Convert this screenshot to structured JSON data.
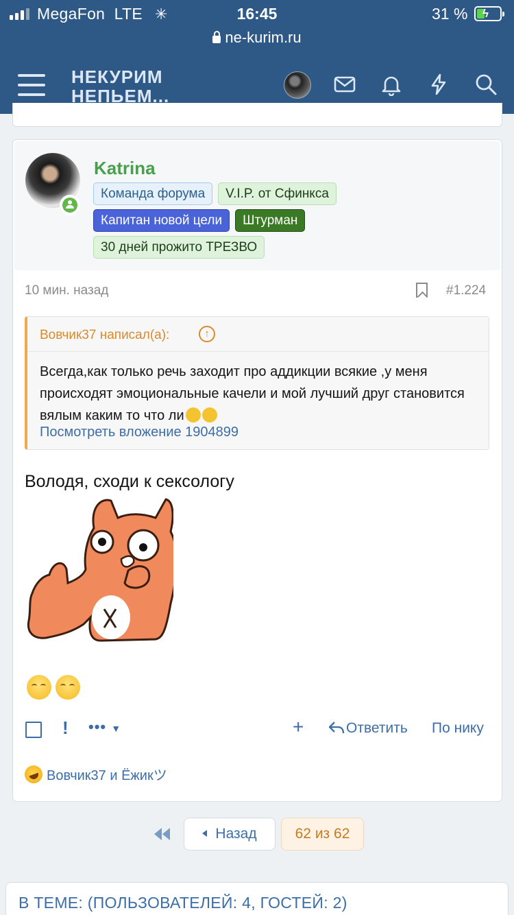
{
  "status_bar": {
    "carrier": "MegaFon",
    "network": "LTE",
    "time": "16:45",
    "battery_percent": "31 %",
    "url": "ne-kurim.ru"
  },
  "header": {
    "logo_line1": "НЕКУРИМ",
    "logo_line2": "НЕПЬЕМ..."
  },
  "post": {
    "author": "Katrina",
    "badges": [
      "Команда форума",
      "V.I.P. от Сфинкса",
      "Капитан новой цели",
      "Штурман",
      "30 дней прожито ТРЕЗВО"
    ],
    "time_ago": "10 мин. назад",
    "post_number": "#1.224",
    "quote": {
      "header": "Вовчик37 написал(а):",
      "text": "Всегда,как только речь заходит про аддикции всякие ,у меня происходят эмоциональные качели и мой лучший друг становится вялым каким то что ли",
      "attachment_link": "Посмотреть вложение 1904899"
    },
    "message": "Володя, сходи к сексологу",
    "actions": {
      "report": "!",
      "more": "•••",
      "plus": "+",
      "reply": "Ответить",
      "by_nick": "По нику"
    },
    "reactions_text": "Вовчик37 и Ёжикツ"
  },
  "pagination": {
    "back": "Назад",
    "pages": "62 из 62"
  },
  "online": {
    "text": "В ТЕМЕ: (ПОЛЬЗОВАТЕЛЕЙ: 4, ГОСТЕЙ: 2)"
  },
  "colors": {
    "header_bg": "#2e5886",
    "link": "#3b6ea8",
    "username": "#47a04a",
    "quote_accent": "#f0a94a"
  }
}
